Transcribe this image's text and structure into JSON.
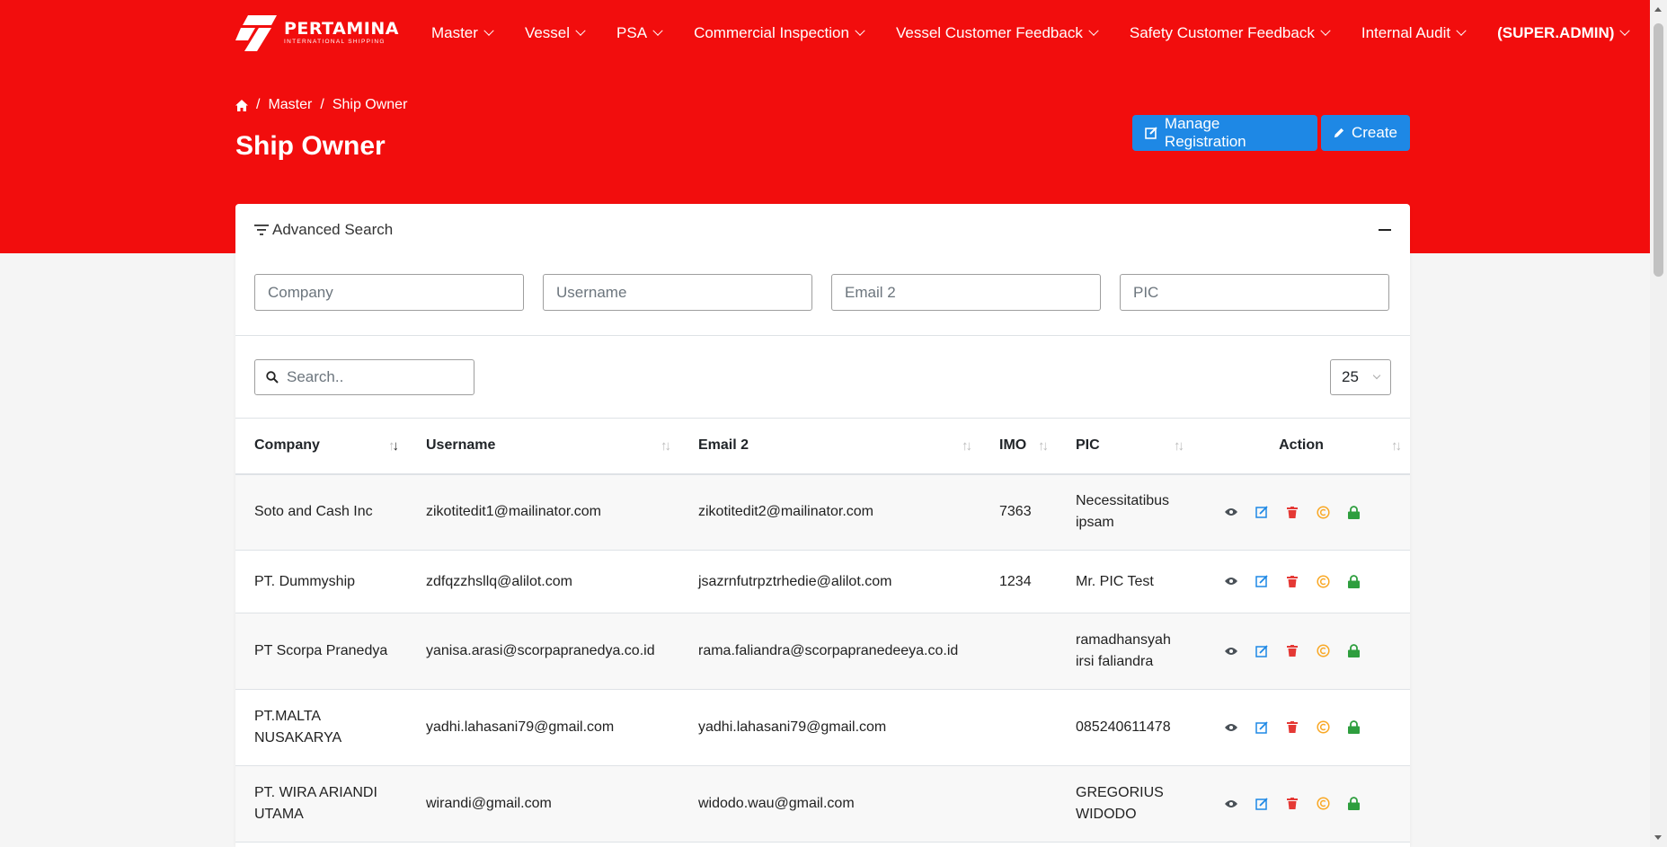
{
  "brand": {
    "name": "PERTAMINA",
    "sub": "INTERNATIONAL SHIPPING"
  },
  "nav": [
    "Master",
    "Vessel",
    "PSA",
    "Commercial Inspection",
    "Vessel Customer Feedback",
    "Safety Customer Feedback",
    "Internal Audit"
  ],
  "user": "(SUPER.ADMIN)",
  "breadcrumb": {
    "level1": "Master",
    "current": "Ship Owner"
  },
  "page_title": "Ship Owner",
  "buttons": {
    "manage": "Manage Registration",
    "create": "Create"
  },
  "advanced_search": {
    "title": "Advanced Search",
    "placeholders": {
      "company": "Company",
      "username": "Username",
      "email2": "Email 2",
      "pic": "PIC"
    }
  },
  "search": {
    "placeholder": "Search.."
  },
  "page_size": "25",
  "table": {
    "headers": {
      "company": "Company",
      "username": "Username",
      "email2": "Email 2",
      "imo": "IMO",
      "pic": "PIC",
      "action": "Action"
    },
    "rows": [
      {
        "company": "Soto and Cash Inc",
        "username": "zikotitedit1@mailinator.com",
        "email2": "zikotitedit2@mailinator.com",
        "imo": "7363",
        "pic": "Necessitatibus ipsam"
      },
      {
        "company": "PT. Dummyship",
        "username": "zdfqzzhsllq@alilot.com",
        "email2": "jsazrnfutrpztrhedie@alilot.com",
        "imo": "1234",
        "pic": "Mr. PIC Test"
      },
      {
        "company": "PT Scorpa Pranedya",
        "username": "yanisa.arasi@scorpapranedya.co.id",
        "email2": "rama.faliandra@scorpapranedeeya.co.id",
        "imo": "",
        "pic": "ramadhansyah irsi faliandra"
      },
      {
        "company": "PT.MALTA NUSAKARYA",
        "username": "yadhi.lahasani79@gmail.com",
        "email2": "yadhi.lahasani79@gmail.com",
        "imo": "",
        "pic": "085240611478"
      },
      {
        "company": "PT. WIRA ARIANDI UTAMA",
        "username": "wirandi@gmail.com",
        "email2": "widodo.wau@gmail.com",
        "imo": "",
        "pic": "GREGORIUS WIDODO"
      }
    ]
  },
  "colors": {
    "brand_red": "#f20d0d",
    "primary": "#1e88e5",
    "view": "#495057",
    "edit": "#1e88e5",
    "delete": "#e53935",
    "copyright": "#f9a825",
    "lock": "#2e9e3e"
  }
}
